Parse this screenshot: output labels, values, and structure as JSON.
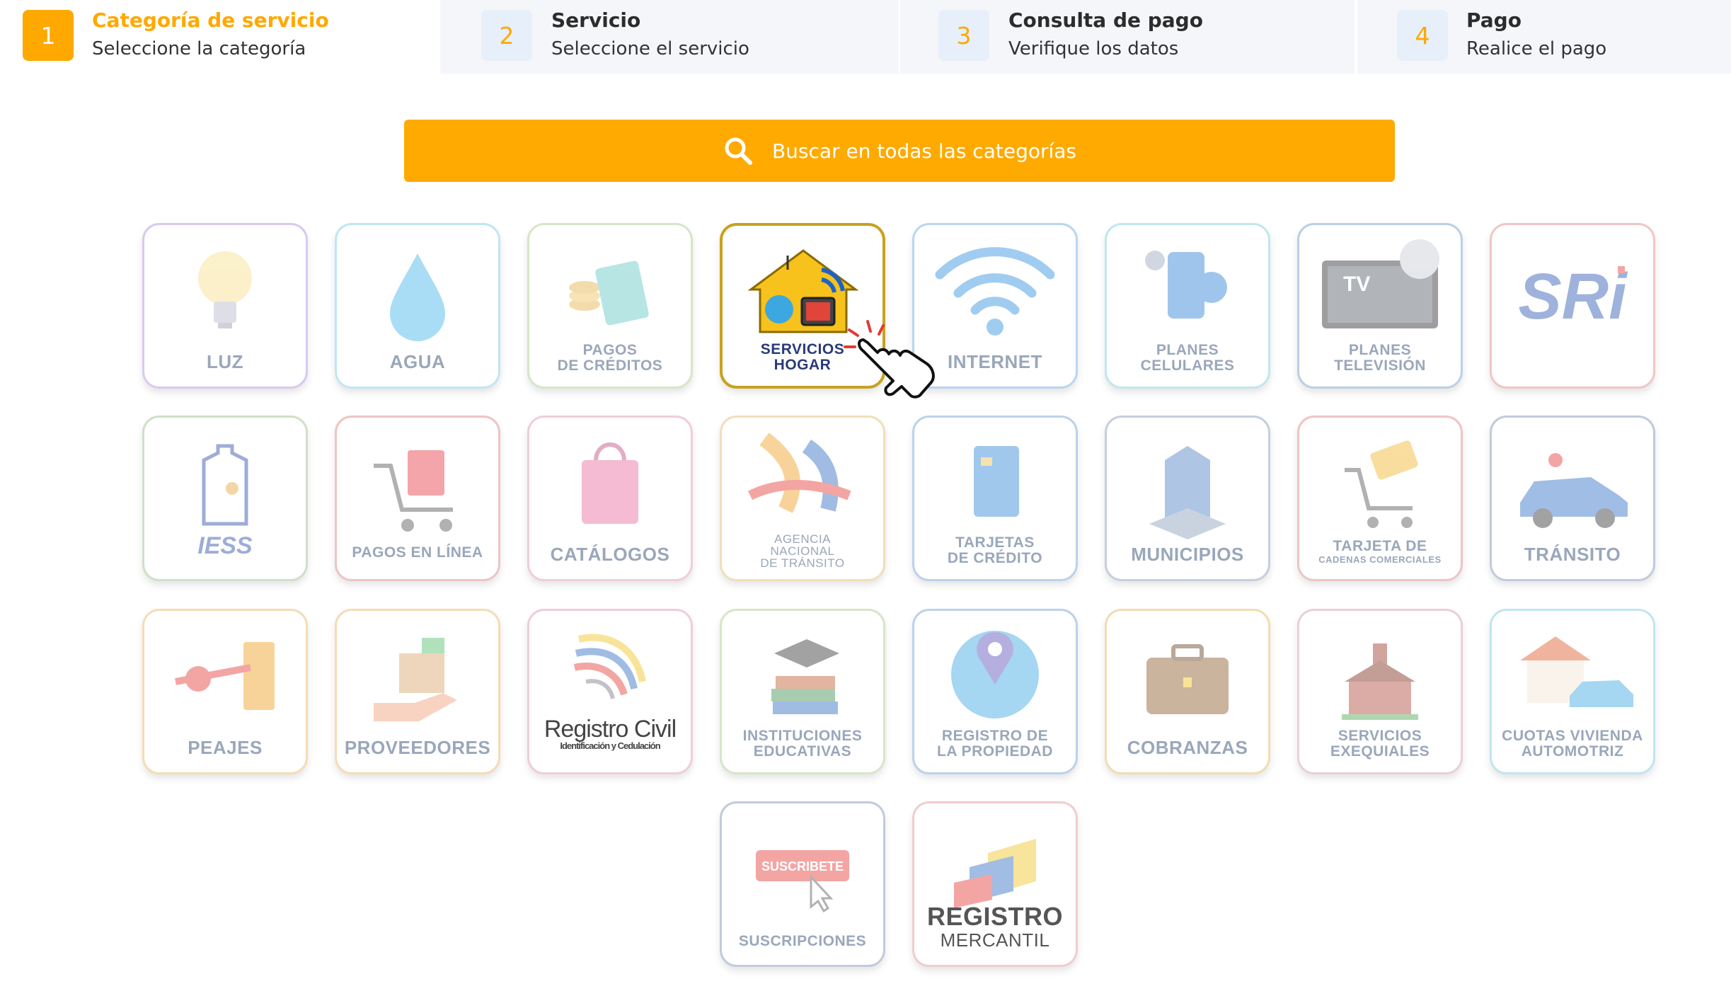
{
  "steps": [
    {
      "number": "1",
      "title": "Categoría de servicio",
      "subtitle": "Seleccione la categoría"
    },
    {
      "number": "2",
      "title": "Servicio",
      "subtitle": "Seleccione el servicio"
    },
    {
      "number": "3",
      "title": "Consulta de pago",
      "subtitle": "Verifique los datos"
    },
    {
      "number": "4",
      "title": "Pago",
      "subtitle": "Realice el pago"
    }
  ],
  "search": {
    "label": "Buscar en todas las categorías",
    "icon": "search-icon"
  },
  "categories": {
    "luz": {
      "line1": "LUZ"
    },
    "agua": {
      "line1": "AGUA"
    },
    "pagos_creditos": {
      "line1": "PAGOS",
      "line2": "DE CRÉDITOS"
    },
    "servicios_hogar": {
      "line1": "SERVICIOS",
      "line2": "HOGAR"
    },
    "internet": {
      "line1": "INTERNET"
    },
    "planes_celulares": {
      "line1": "PLANES",
      "line2": "CELULARES"
    },
    "planes_television": {
      "line1": "PLANES",
      "line2": "TELEVISIÓN",
      "art_text": "TV"
    },
    "sri": {
      "logo": "SRi"
    },
    "iess": {
      "logo": "IESS"
    },
    "pagos_linea": {
      "line1": "PAGOS EN LÍNEA"
    },
    "catalogos": {
      "line1": "CATÁLOGOS"
    },
    "ant": {
      "line1": "AGENCIA",
      "line2": "NACIONAL",
      "line3": "DE TRÁNSITO"
    },
    "tarjetas_credito": {
      "line1": "TARJETAS",
      "line2": "DE CRÉDITO"
    },
    "municipios": {
      "line1": "MUNICIPIOS"
    },
    "tarjeta_cadenas": {
      "line1": "TARJETA DE",
      "line2": "CADENAS COMERCIALES"
    },
    "transito": {
      "line1": "TRÁNSITO"
    },
    "peajes": {
      "line1": "PEAJES"
    },
    "proveedores": {
      "line1": "PROVEEDORES"
    },
    "registro_civil": {
      "line1": "Registro Civil",
      "line2": "Identificación y Cedulación"
    },
    "instituciones": {
      "line1": "INSTITUCIONES",
      "line2": "EDUCATIVAS"
    },
    "registro_propiedad": {
      "line1": "REGISTRO DE",
      "line2": "LA PROPIEDAD"
    },
    "cobranzas": {
      "line1": "COBRANZAS"
    },
    "servicios_exequiales": {
      "line1": "SERVICIOS",
      "line2": "EXEQUIALES"
    },
    "cuotas_vivienda": {
      "line1": "CUOTAS VIVIENDA",
      "line2": "AUTOMOTRIZ"
    },
    "suscripciones": {
      "line1": "SUSCRIPCIONES",
      "button": "SUSCRIBETE"
    },
    "registro_mercantil": {
      "line1": "REGISTRO",
      "line2": "MERCANTIL"
    }
  },
  "colors": {
    "accent": "#ffa800",
    "search_bg": "#ffaa00",
    "selected_border": "#c8a21e",
    "step_bg": "#f4f6fa"
  }
}
